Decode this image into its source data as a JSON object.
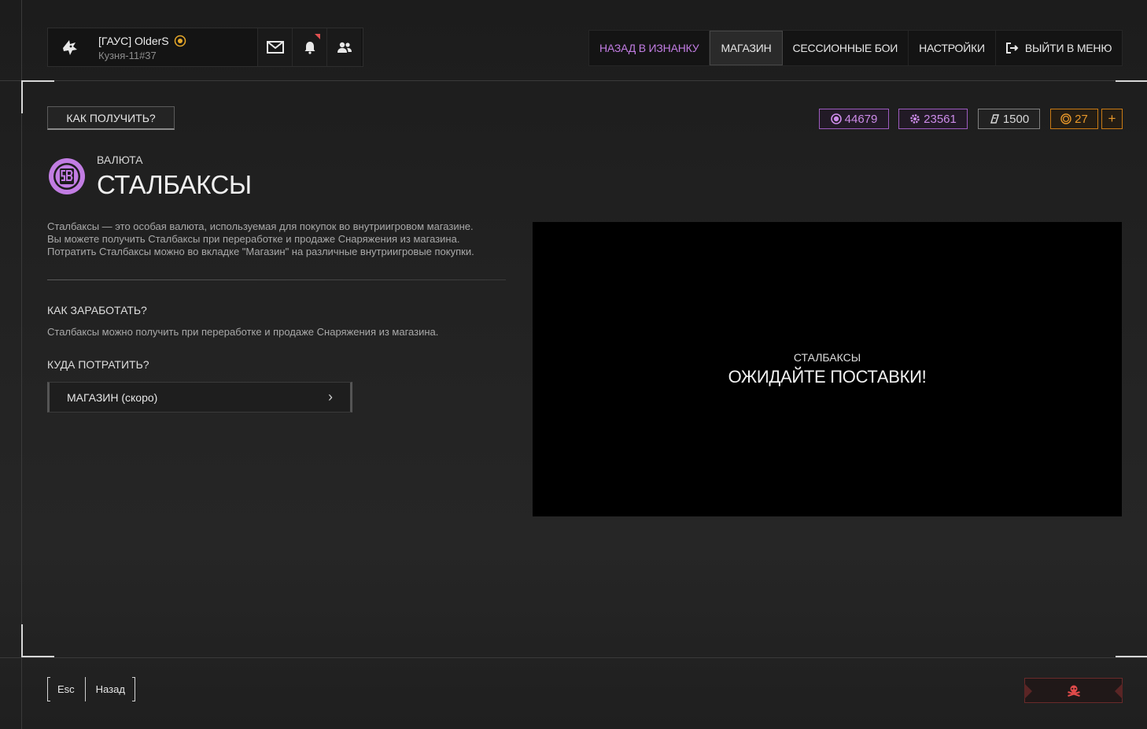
{
  "profile": {
    "name": "[ГАУС] OlderS",
    "location": "Кузня-11#37"
  },
  "nav": {
    "items": [
      {
        "label": "НАЗАД В ИЗНАНКУ"
      },
      {
        "label": "МАГАЗИН"
      },
      {
        "label": "СЕССИОННЫЕ БОИ"
      },
      {
        "label": "НАСТРОЙКИ"
      },
      {
        "label": "ВЫЙТИ В МЕНЮ"
      }
    ],
    "active": "МАГАЗИН"
  },
  "how_to_get_label": "КАК ПОЛУЧИТЬ?",
  "currencies": {
    "stalbucks": "44679",
    "secondary": "23561",
    "tickets": "1500",
    "gold": "27",
    "add": "+"
  },
  "currency_page": {
    "category": "ВАЛЮТА",
    "title": "СТАЛБАКСЫ",
    "description": [
      "Сталбаксы — это особая валюта, используемая для покупок во внутриигровом магазине.",
      "Вы можете получить Сталбаксы при переработке и продаже Снаряжения из магазина.",
      "Потратить Сталбаксы можно во вкладке \"Магазин\" на различные внутриигровые покупки."
    ],
    "earn_heading": "КАК ЗАРАБОТАТЬ?",
    "earn_text": "Сталбаксы можно получить при переработке и продаже Снаряжения из магазина.",
    "spend_heading": "КУДА ПОТРАТИТЬ?",
    "shop_button_label": "МАГАЗИН (скоро)",
    "shop_arrow": "›"
  },
  "video": {
    "subtitle": "СТАЛБАКСЫ",
    "headline": "ОЖИДАЙТЕ ПОСТАВКИ!"
  },
  "footer": {
    "esc_key": "Esc",
    "back_label": "Назад"
  },
  "colors": {
    "accent_purple": "#c27de3",
    "accent_orange": "#e8982a",
    "report_red": "#e04a4a"
  }
}
